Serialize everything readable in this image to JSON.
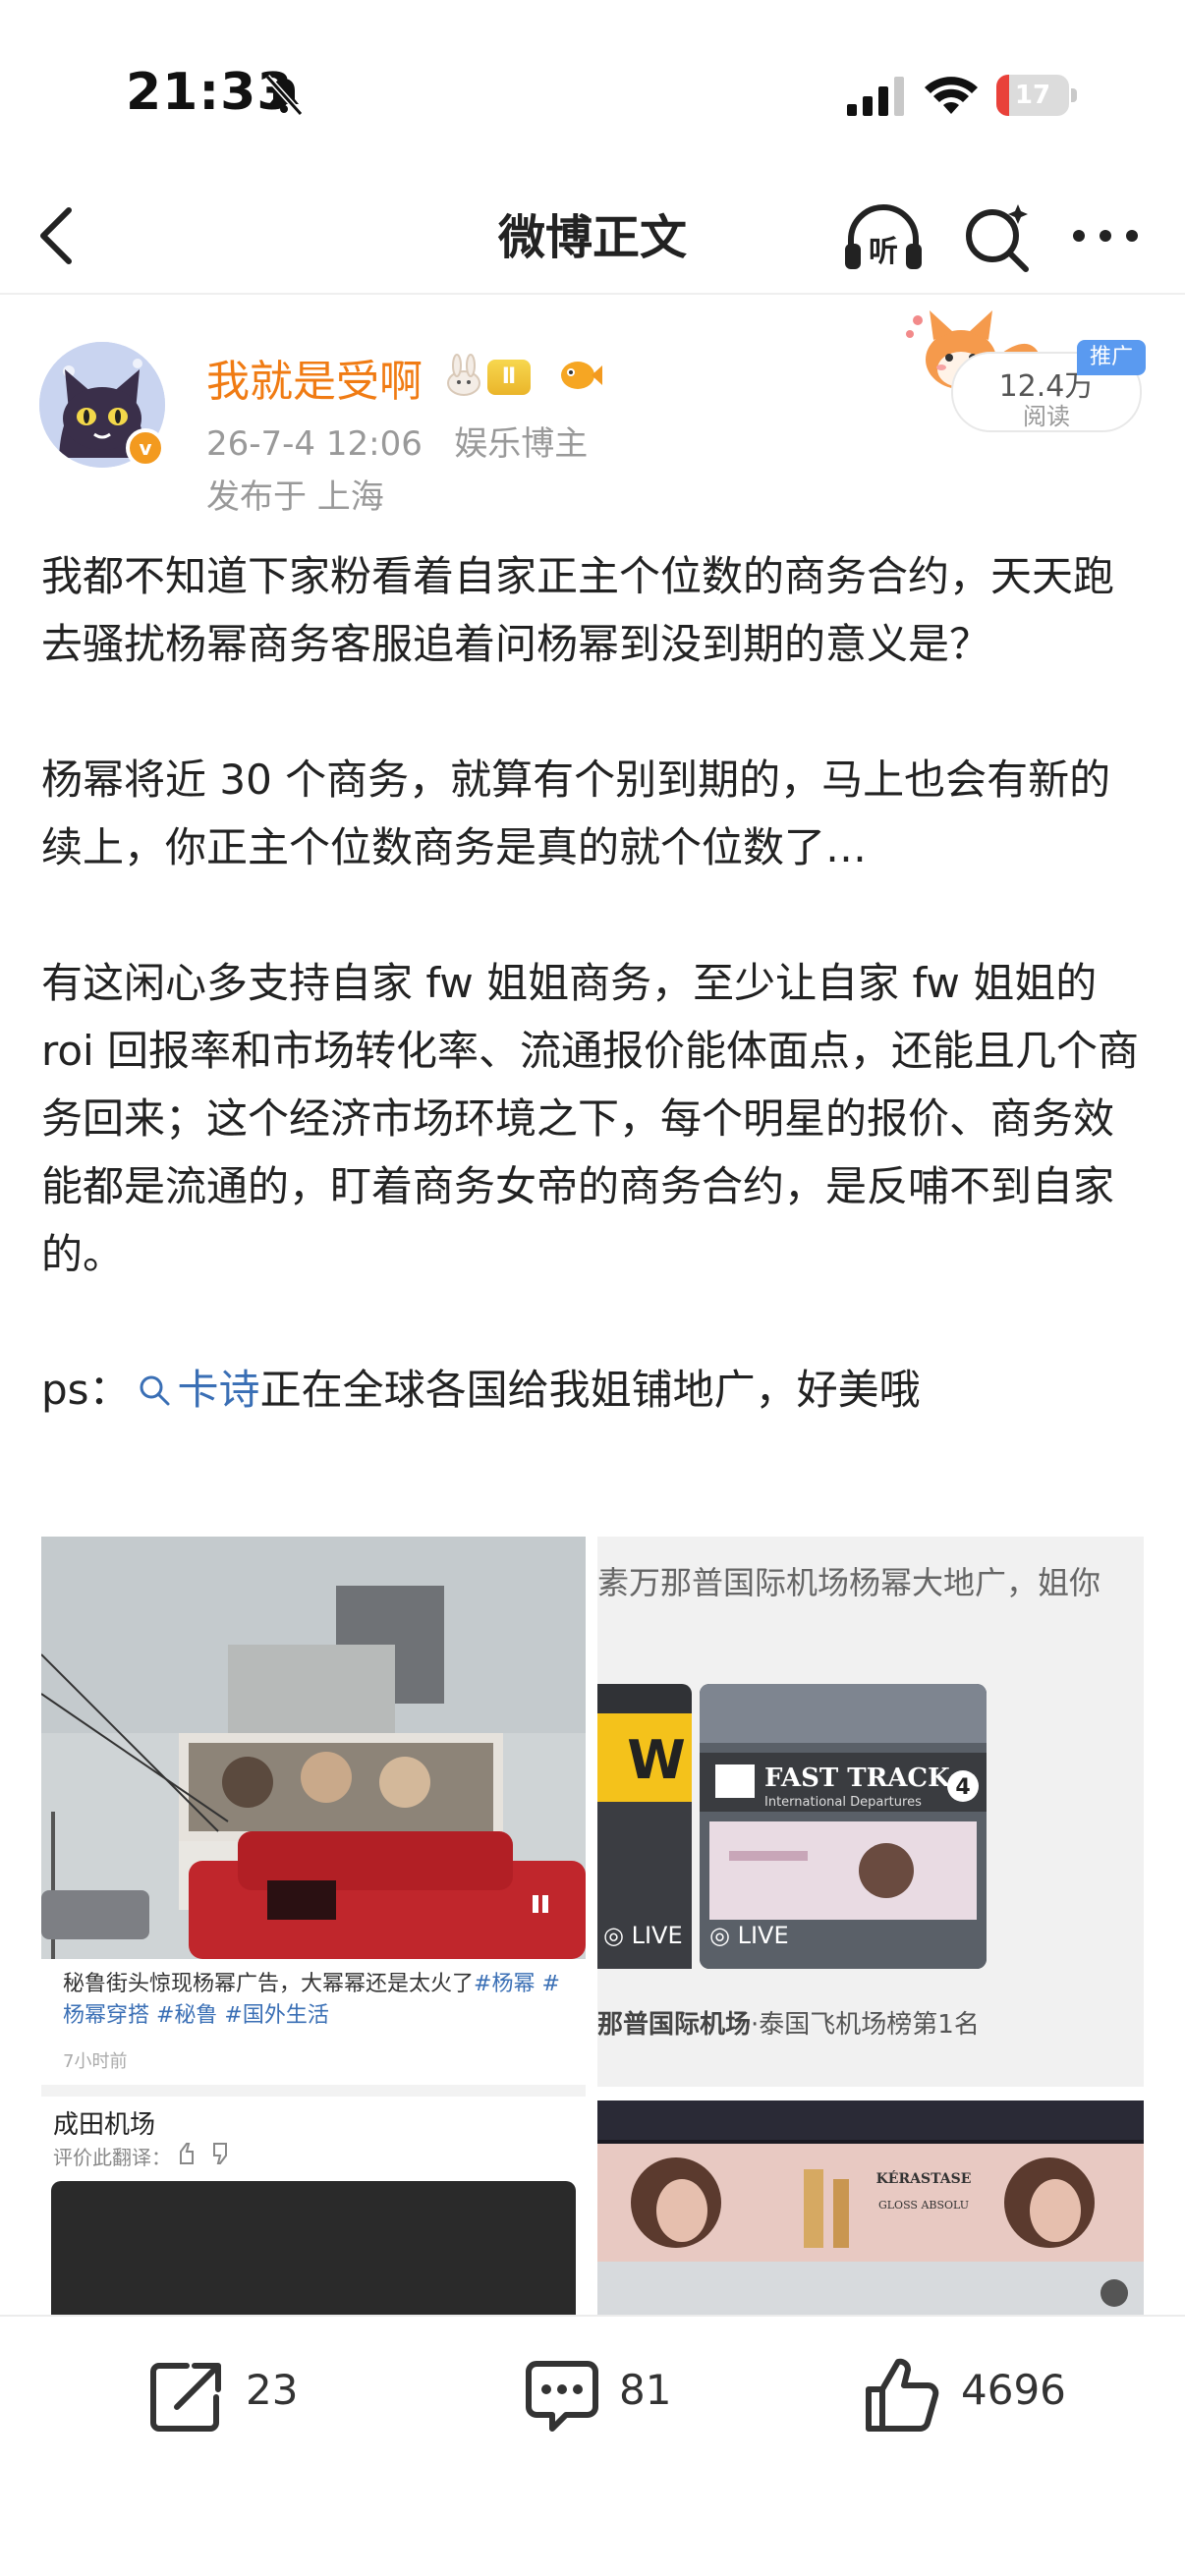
{
  "status_bar": {
    "time": "21:33",
    "battery": "17",
    "battery_level": 0.17,
    "battery_color": "#e9413a"
  },
  "nav": {
    "title": "微博正文",
    "listen_label": "听",
    "icons": [
      "back-arrow-icon",
      "listen-headphones-icon",
      "search-icon",
      "more-icon"
    ]
  },
  "post": {
    "author": "我就是受啊",
    "level_badge": "Ⅱ",
    "time": "26-7-4 12:06",
    "author_role": "娱乐博主",
    "location": "发布于 上海",
    "read_count": "12.4万",
    "read_label": "阅读",
    "promo_tag": "推广",
    "accent_color": "#f07b13",
    "link_color": "#3a6fb5",
    "paragraphs": [
      "我都不知道下家粉看着自家正主个位数的商务合约，天天跑去骚扰杨幂商务客服追着问杨幂到没到期的意义是？",
      "杨幂将近 30 个商务，就算有个别到期的，马上也会有新的续上，你正主个位数商务是真的就个位数了…",
      "有这闲心多支持自家 fw 姐姐商务，至少让自家 fw 姐姐的 roi 回报率和市场转化率、流通报价能体面点，还能且几个商务回来；这个经济市场环境之下，每个明星的报价、商务效能都是流通的，盯着商务女帝的商务合约，是反哺不到自家的。"
    ],
    "ps_prefix": "ps：",
    "ps_link": "卡诗",
    "ps_suffix": "正在全球各国给我姐铺地广，好美哦"
  },
  "images": {
    "img1": {
      "caption_text": "秘鲁街头惊现杨幂广告，大幂幂还是太火了",
      "caption_tags": "#杨幂 # 杨幂穿搭 #秘鲁 #国外生活",
      "time_ago": "7小时前",
      "place": "成田机场",
      "rate_label": "评价此翻译："
    },
    "img2": {
      "title": "素万那普国际机场杨幂大地广，姐你",
      "live_label": "LIVE",
      "sign_text": "FAST TRACK",
      "sign_sub": "International Departures",
      "sign_gate": "4",
      "sign_letter": "W",
      "airport_name": "那普国际机场",
      "airport_rank": "·泰国飞机场榜第1名",
      "ad_brand": "KÉRASTASE",
      "ad_product": "GLOSS ABSOLU"
    }
  },
  "actions": {
    "share_count": "23",
    "comment_count": "81",
    "like_count": "4696"
  }
}
